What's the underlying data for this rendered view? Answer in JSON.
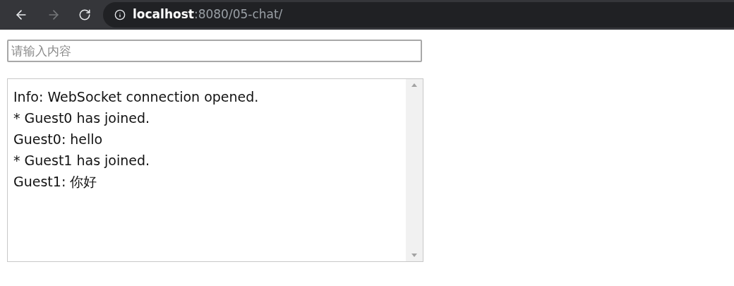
{
  "browser": {
    "back_disabled": false,
    "forward_disabled": true,
    "url_host": "localhost",
    "url_rest": ":8080/05-chat/"
  },
  "message_input": {
    "placeholder": "请输入内容"
  },
  "chat_log": {
    "lines": [
      "Info: WebSocket connection opened.",
      "* Guest0 has joined.",
      "Guest0: hello",
      "* Guest1 has joined.",
      "Guest1: 你好"
    ]
  }
}
